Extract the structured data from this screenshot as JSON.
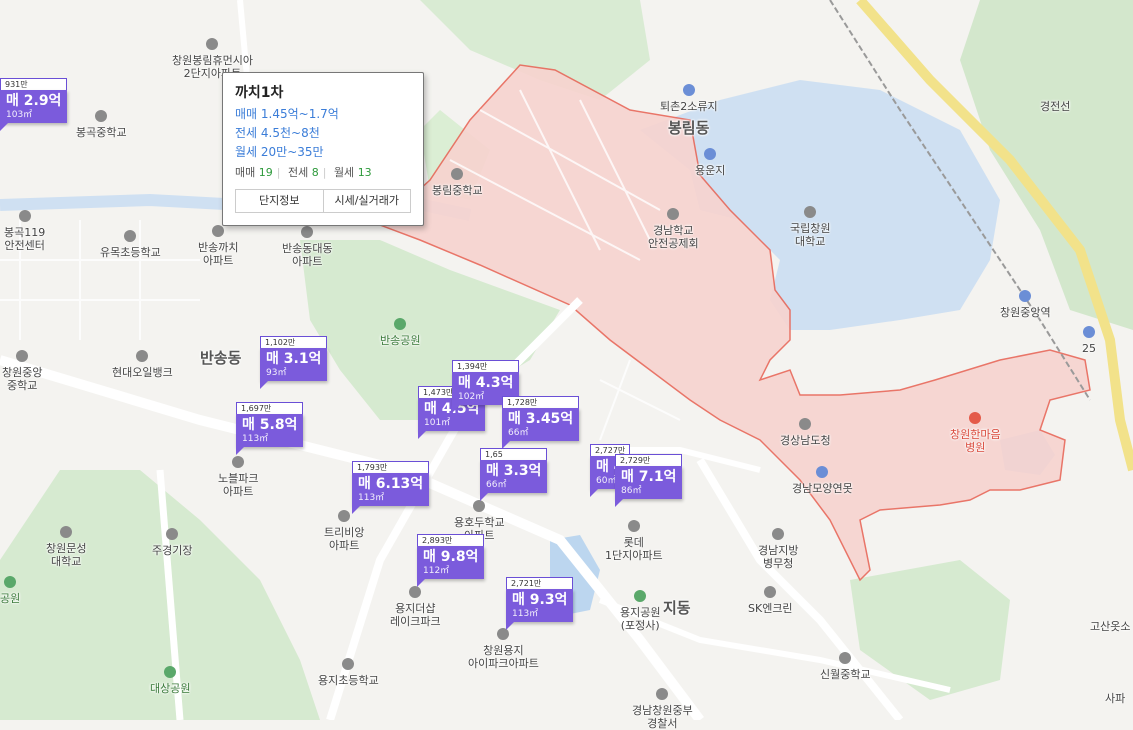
{
  "map": {
    "colors": {
      "land": "#f4f3f0",
      "park": "#d6ead0",
      "highlight": "#f7d3cf",
      "highlight_border": "#e8685a",
      "water": "#cfe0f2",
      "marker": "#7b5bdc",
      "road": "#ffffff"
    },
    "labels": [
      {
        "id": "bongrim",
        "text": "봉림동",
        "type": "dist"
      },
      {
        "id": "bansong",
        "text": "반송동",
        "type": "dist"
      },
      {
        "id": "yongji",
        "text": "지동",
        "type": "dist"
      },
      {
        "id": "toechon",
        "text": "퇴촌2소류지",
        "icon": "water-icon"
      },
      {
        "id": "yongunji",
        "text": "용운지",
        "icon": "water-icon"
      },
      {
        "id": "gukrip",
        "text": "국립창원\n대학교",
        "icon": "school-icon"
      },
      {
        "id": "gyeongnam_anjeon",
        "text": "경남학교\n안전공제회",
        "icon": "building-icon"
      },
      {
        "id": "bongrim_ms",
        "text": "봉림중학교",
        "icon": "school-icon"
      },
      {
        "id": "bonggok_ms",
        "text": "봉곡중학교",
        "icon": "school-icon"
      },
      {
        "id": "bonggok119",
        "text": "봉곡119\n안전센터",
        "icon": "fire-icon"
      },
      {
        "id": "yumok",
        "text": "유목초등학교",
        "icon": "school-icon"
      },
      {
        "id": "bansong_kkachi",
        "text": "반송까치\n아파트",
        "icon": "building-icon"
      },
      {
        "id": "bansong_daedong",
        "text": "반송동대동\n아파트",
        "icon": "building-icon"
      },
      {
        "id": "bansong_park",
        "text": "반송공원",
        "icon": "park-icon",
        "type": "park"
      },
      {
        "id": "changwon_jungang_ms",
        "text": "창원중앙\n중학교",
        "icon": "school-icon"
      },
      {
        "id": "hyundai_bank",
        "text": "현대오일뱅크",
        "icon": "gas-icon"
      },
      {
        "id": "noble",
        "text": "노블파크\n아파트",
        "icon": "building-icon"
      },
      {
        "id": "tri",
        "text": "트리비앙\n아파트",
        "icon": "building-icon"
      },
      {
        "id": "jugyeonggijang",
        "text": "주경기장",
        "icon": "stadium-icon"
      },
      {
        "id": "munseong",
        "text": "창원문성\n대학교",
        "icon": "school-icon"
      },
      {
        "id": "yongho",
        "text": "용호두학교\n아파트",
        "icon": "school-icon"
      },
      {
        "id": "lotte",
        "text": "롯데\n1단지아파트",
        "icon": "building-icon"
      },
      {
        "id": "yongji_lake",
        "text": "용지더샵\n레이크파크",
        "icon": "building-icon"
      },
      {
        "id": "yongji_ipark",
        "text": "창원용지\n아이파크아파트",
        "icon": "building-icon"
      },
      {
        "id": "yongji_elem",
        "text": "용지초등학교",
        "icon": "school-icon"
      },
      {
        "id": "daesang",
        "text": "대상공원",
        "icon": "park-icon",
        "type": "park"
      },
      {
        "id": "yongji_park",
        "text": "용지공원\n(포정사)",
        "icon": "park-icon"
      },
      {
        "id": "gyeongnam_hospital",
        "text": "경남지방\n병무청",
        "icon": "building-icon"
      },
      {
        "id": "sk",
        "text": "SK엔크린",
        "icon": "gas-icon"
      },
      {
        "id": "sinwol",
        "text": "신월중학교",
        "icon": "school-icon"
      },
      {
        "id": "gyeongnam_gov",
        "text": "경상남도청",
        "icon": "building-icon"
      },
      {
        "id": "gyeongnam_yeonmot",
        "text": "경남모양연못",
        "icon": "water-icon"
      },
      {
        "id": "hanmaum",
        "text": "창원한마음\n병원",
        "icon": "hospital-icon",
        "type": "red"
      },
      {
        "id": "changwon_station",
        "text": "창원중앙역",
        "icon": "train-icon"
      },
      {
        "id": "bongrim_hyu",
        "text": "창원봉림휴먼시아\n2단지아파트",
        "icon": "building-icon"
      },
      {
        "id": "gosan",
        "text": "고산옷소",
        "icon": ""
      },
      {
        "id": "sapa",
        "text": "사파",
        "icon": ""
      },
      {
        "id": "gyeongnam_central",
        "text": "경남창원중부\n경찰서",
        "icon": "police-icon"
      },
      {
        "id": "wonpark",
        "text": "공원",
        "icon": "park-icon",
        "type": "park"
      },
      {
        "id": "gyeongjeon",
        "text": "경전선",
        "icon": ""
      },
      {
        "id": "route25",
        "text": "25",
        "icon": "highway-icon"
      }
    ]
  },
  "markers": [
    {
      "price": "매 2.9억",
      "area": "103㎡",
      "top": "931만"
    },
    {
      "price": "매 3.1억",
      "area": "93㎡",
      "top": "1,102만"
    },
    {
      "price": "매 5.8억",
      "area": "113㎡",
      "top": "1,697만"
    },
    {
      "price": "매 4.5억",
      "area": "101㎡",
      "top": "1,473만"
    },
    {
      "price": "매 4.3억",
      "area": "102㎡",
      "top": "1,394만"
    },
    {
      "price": "매 3.45억",
      "area": "66㎡",
      "top": "1,728만"
    },
    {
      "price": "매 3.3억",
      "area": "66㎡",
      "top": "1,65"
    },
    {
      "price": "매 6.13억",
      "area": "113㎡",
      "top": "1,793만"
    },
    {
      "price": "매 4",
      "area": "60㎡",
      "top": "2,727만"
    },
    {
      "price": "매 7.1억",
      "area": "86㎡",
      "top": "2,729만"
    },
    {
      "price": "매 9.8억",
      "area": "112㎡",
      "top": "2,893만"
    },
    {
      "price": "매 9.3억",
      "area": "113㎡",
      "top": "2,721만"
    }
  ],
  "popup": {
    "title": "까치1차",
    "sale": "매매 1.45억~1.7억",
    "jeonse": "전세 4.5천~8천",
    "wolse": "월세 20만~35만",
    "counts": {
      "sale_label": "매매",
      "sale_n": "19",
      "jeonse_label": "전세",
      "jeonse_n": "8",
      "wolse_label": "월세",
      "wolse_n": "13"
    },
    "btn_info": "단지정보",
    "btn_price": "시세/실거래가"
  }
}
